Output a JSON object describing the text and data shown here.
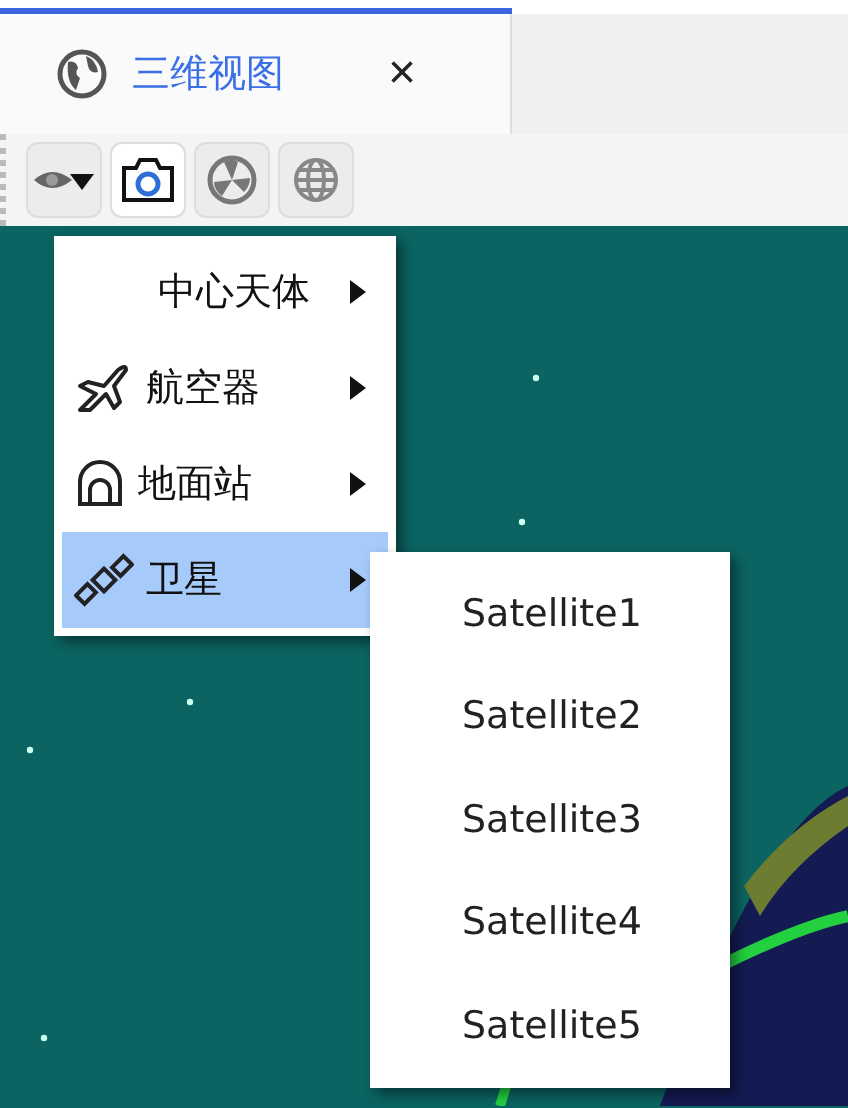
{
  "tab": {
    "title": "三维视图",
    "close": "×",
    "selected": true
  },
  "toolbar": [
    {
      "kind": "eye",
      "pressed": false
    },
    {
      "kind": "camera",
      "pressed": true
    },
    {
      "kind": "fan",
      "pressed": false
    },
    {
      "kind": "globe",
      "pressed": false
    }
  ],
  "menu": {
    "items": [
      {
        "label": "中心天体",
        "kind": "body",
        "selected": false
      },
      {
        "label": "航空器",
        "kind": "aircraft",
        "selected": false
      },
      {
        "label": "地面站",
        "kind": "station",
        "selected": false
      },
      {
        "label": "卫星",
        "kind": "satellite",
        "selected": true
      }
    ]
  },
  "submenu": {
    "items": [
      {
        "label": "Satellite1",
        "selected": false
      },
      {
        "label": "Satellite2",
        "selected": false
      },
      {
        "label": "Satellite3",
        "selected": false
      },
      {
        "label": "Satellite4",
        "selected": false
      },
      {
        "label": "Satellite5",
        "selected": false
      }
    ]
  }
}
